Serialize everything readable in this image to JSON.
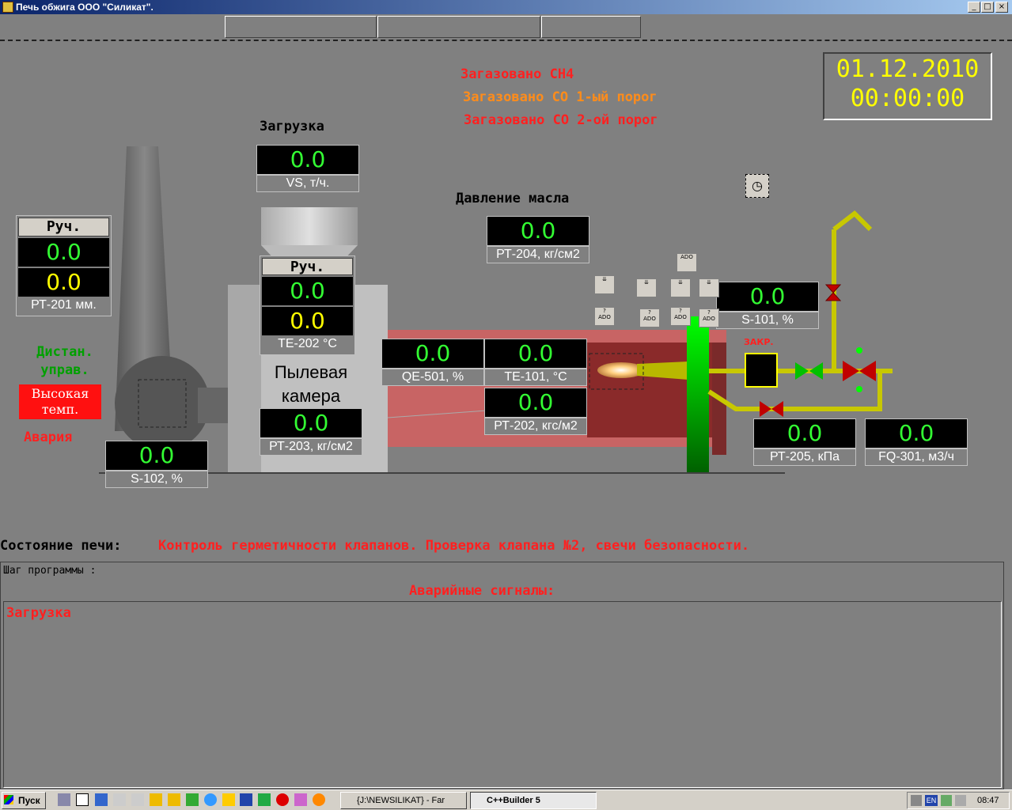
{
  "window": {
    "title": "Печь обжига ООО \"Силикат\"."
  },
  "alarms_top": {
    "ch4": "Загазовано СН4",
    "co1": "Загазовано СО 1-ый порог",
    "co2": "Загазовано СО 2-ой порог"
  },
  "clock": {
    "date": "01.12.2010",
    "time": "00:00:00"
  },
  "loading": {
    "title": "Загрузка",
    "value": "0.0",
    "label": "VS, т/ч."
  },
  "oil_pressure": {
    "title": "Давление масла",
    "value": "0.0",
    "label": "РТ-204, кг/см2"
  },
  "pt201": {
    "mode": "Руч.",
    "value1": "0.0",
    "value2": "0.0",
    "label": "РТ-201  мм."
  },
  "te202": {
    "mode": "Руч.",
    "value1": "0.0",
    "value2": "0.0",
    "label": "ТЕ-202  °С"
  },
  "dust_chamber": {
    "line1": "Пылевая",
    "line2": "камера"
  },
  "pt203": {
    "value": "0.0",
    "label": "РТ-203, кг/см2"
  },
  "qe501": {
    "value": "0.0",
    "label": "QE-501, %"
  },
  "te101": {
    "value": "0.0",
    "label": "ТЕ-101, °С"
  },
  "pt202": {
    "value": "0.0",
    "label": "РТ-202, кгс/м2"
  },
  "s101": {
    "value": "0.0",
    "label": "S-101, %"
  },
  "s102": {
    "value": "0.0",
    "label": "S-102, %"
  },
  "pt205": {
    "value": "0.0",
    "label": "РТ-205, кПа"
  },
  "fq301": {
    "value": "0.0",
    "label": "FQ-301, м3/ч"
  },
  "valve_label": "ЗАКР.",
  "remote": {
    "line1": "Дистан.",
    "line2": "управ."
  },
  "high_temp": {
    "line1": "Высокая",
    "line2": "темп."
  },
  "alarm_word": "Авария",
  "furnace_state": {
    "label": "Состояние печи:",
    "text": "Контроль герметичности клапанов. Проверка клапана №2, свечи безопасности."
  },
  "program_step": {
    "label": "Шаг программы :"
  },
  "alarm_signals": {
    "title": "Аварийные сигналы:",
    "item": "Загрузка"
  },
  "small_icons": {
    "ado": "ADO"
  },
  "taskbar": {
    "start": "Пуск",
    "task1": "{J:\\NEWSILIKAT} - Far",
    "task2": "C++Builder 5",
    "lang": "EN",
    "time": "08:47"
  },
  "colors": {
    "green_value": "#33ff33",
    "yellow_value": "#ffff00",
    "alarm_red": "#ff2020",
    "pipe_yellow": "#c8c800",
    "furnace": "#c86464"
  },
  "icons": [
    "minimize-icon",
    "maximize-icon",
    "close-icon",
    "clock-icon",
    "valve-icon",
    "flame-icon"
  ]
}
